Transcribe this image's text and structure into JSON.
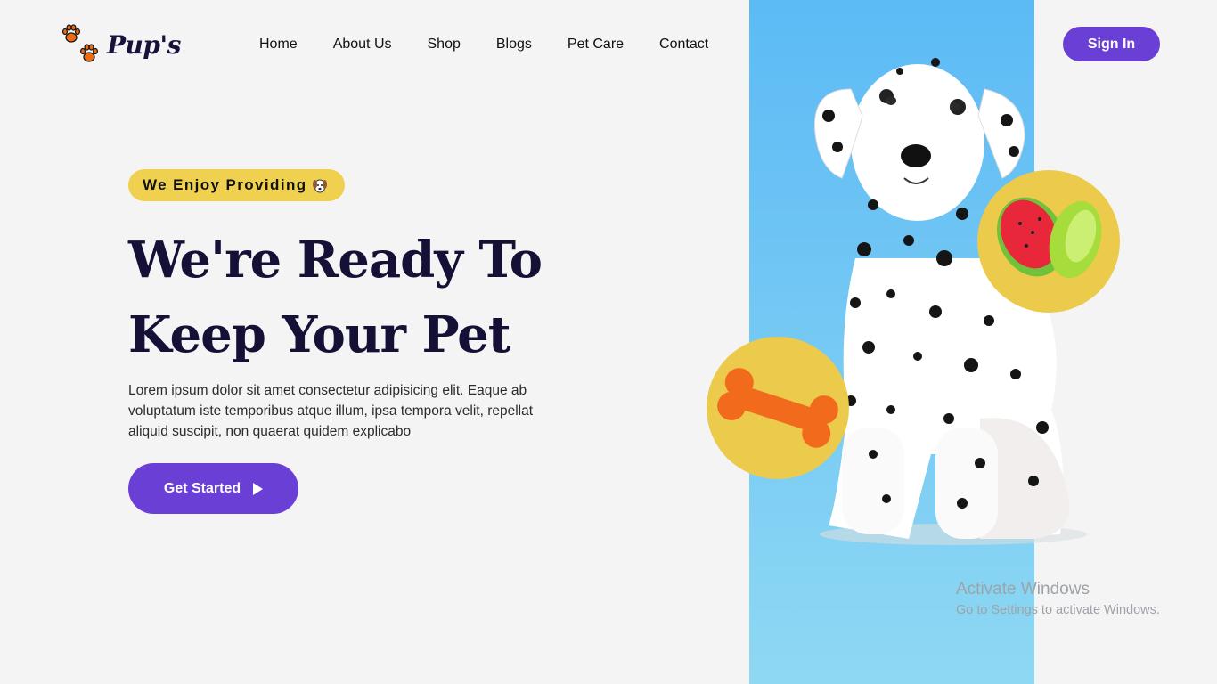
{
  "brand": {
    "name": "Pup's",
    "accent": "#6a3fd6",
    "paw_color": "#f06a12"
  },
  "nav": {
    "items": [
      {
        "label": "Home"
      },
      {
        "label": "About Us"
      },
      {
        "label": "Shop"
      },
      {
        "label": "Blogs"
      },
      {
        "label": "Pet Care"
      },
      {
        "label": "Contact"
      }
    ],
    "signin_label": "Sign In"
  },
  "hero": {
    "badge": "We Enjoy Providing",
    "badge_icon": "dog-face-icon",
    "headline_line1": "We're Ready To",
    "headline_line2": "Keep Your Pet",
    "description": "Lorem ipsum dolor sit amet consectetur adipisicing elit. Eaque ab voluptatum iste temporibus atque illum, ipsa tempora velit, repellat aliquid suscipit, non quaerat quidem explicabo",
    "cta_label": "Get Started",
    "cta_icon": "play-icon"
  },
  "colors": {
    "panel_blue": "#5cbaf5",
    "circle_yellow": "#ecca4c",
    "badge_yellow": "#f0d14f",
    "headline": "#151036"
  },
  "watermark": {
    "title": "Activate Windows",
    "subtitle": "Go to Settings to activate Windows."
  }
}
